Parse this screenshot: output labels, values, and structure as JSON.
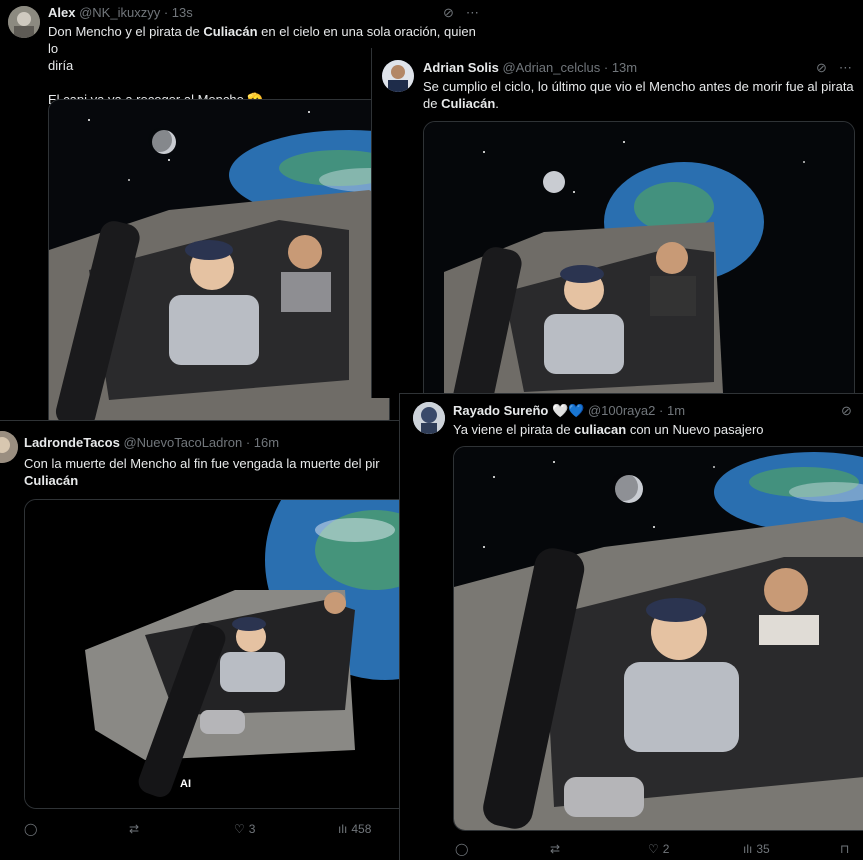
{
  "tweets": [
    {
      "name": "Alex",
      "handle": "@NK_ikuxzyy",
      "time": "13s",
      "text_a": "Don Mencho y el pirata de ",
      "text_b": "Culiacán",
      "text_c": " en el cielo en una sola oración, quien lo",
      "text_d": "diría",
      "text_e": "El capi ya va a recoger al Mencho 🫡"
    },
    {
      "name": "Adrian Solis",
      "handle": "@Adrian_celclus",
      "time": "13m",
      "text_a": "Se cumplio el ciclo, lo último que vio el Mencho antes de morir fue al pirata",
      "text_b": "de ",
      "text_c": "Culiacán",
      "text_d": "."
    },
    {
      "name": "LadrondeTacos",
      "handle": "@NuevoTacoLadron",
      "time": "16m",
      "text_a": "Con la muerte del Mencho al fin fue vengada la muerte del pir",
      "text_b": "Culiacán",
      "ai_label": "AI",
      "likes": "3",
      "views": "458"
    },
    {
      "name": "Rayado Sureño 🤍💙",
      "handle": "@100raya2",
      "time": "1m",
      "text_a": "Ya viene el pirata de ",
      "text_b": "culiacan",
      "text_c": " con un Nuevo pasajero",
      "likes": "2",
      "views": "35"
    }
  ],
  "icons": {
    "grok": "⊘",
    "more": "⋯",
    "reply": "◯",
    "retweet": "⇄",
    "like": "♡",
    "views": "ılı",
    "bookmark": "⊓"
  },
  "separator": "·"
}
